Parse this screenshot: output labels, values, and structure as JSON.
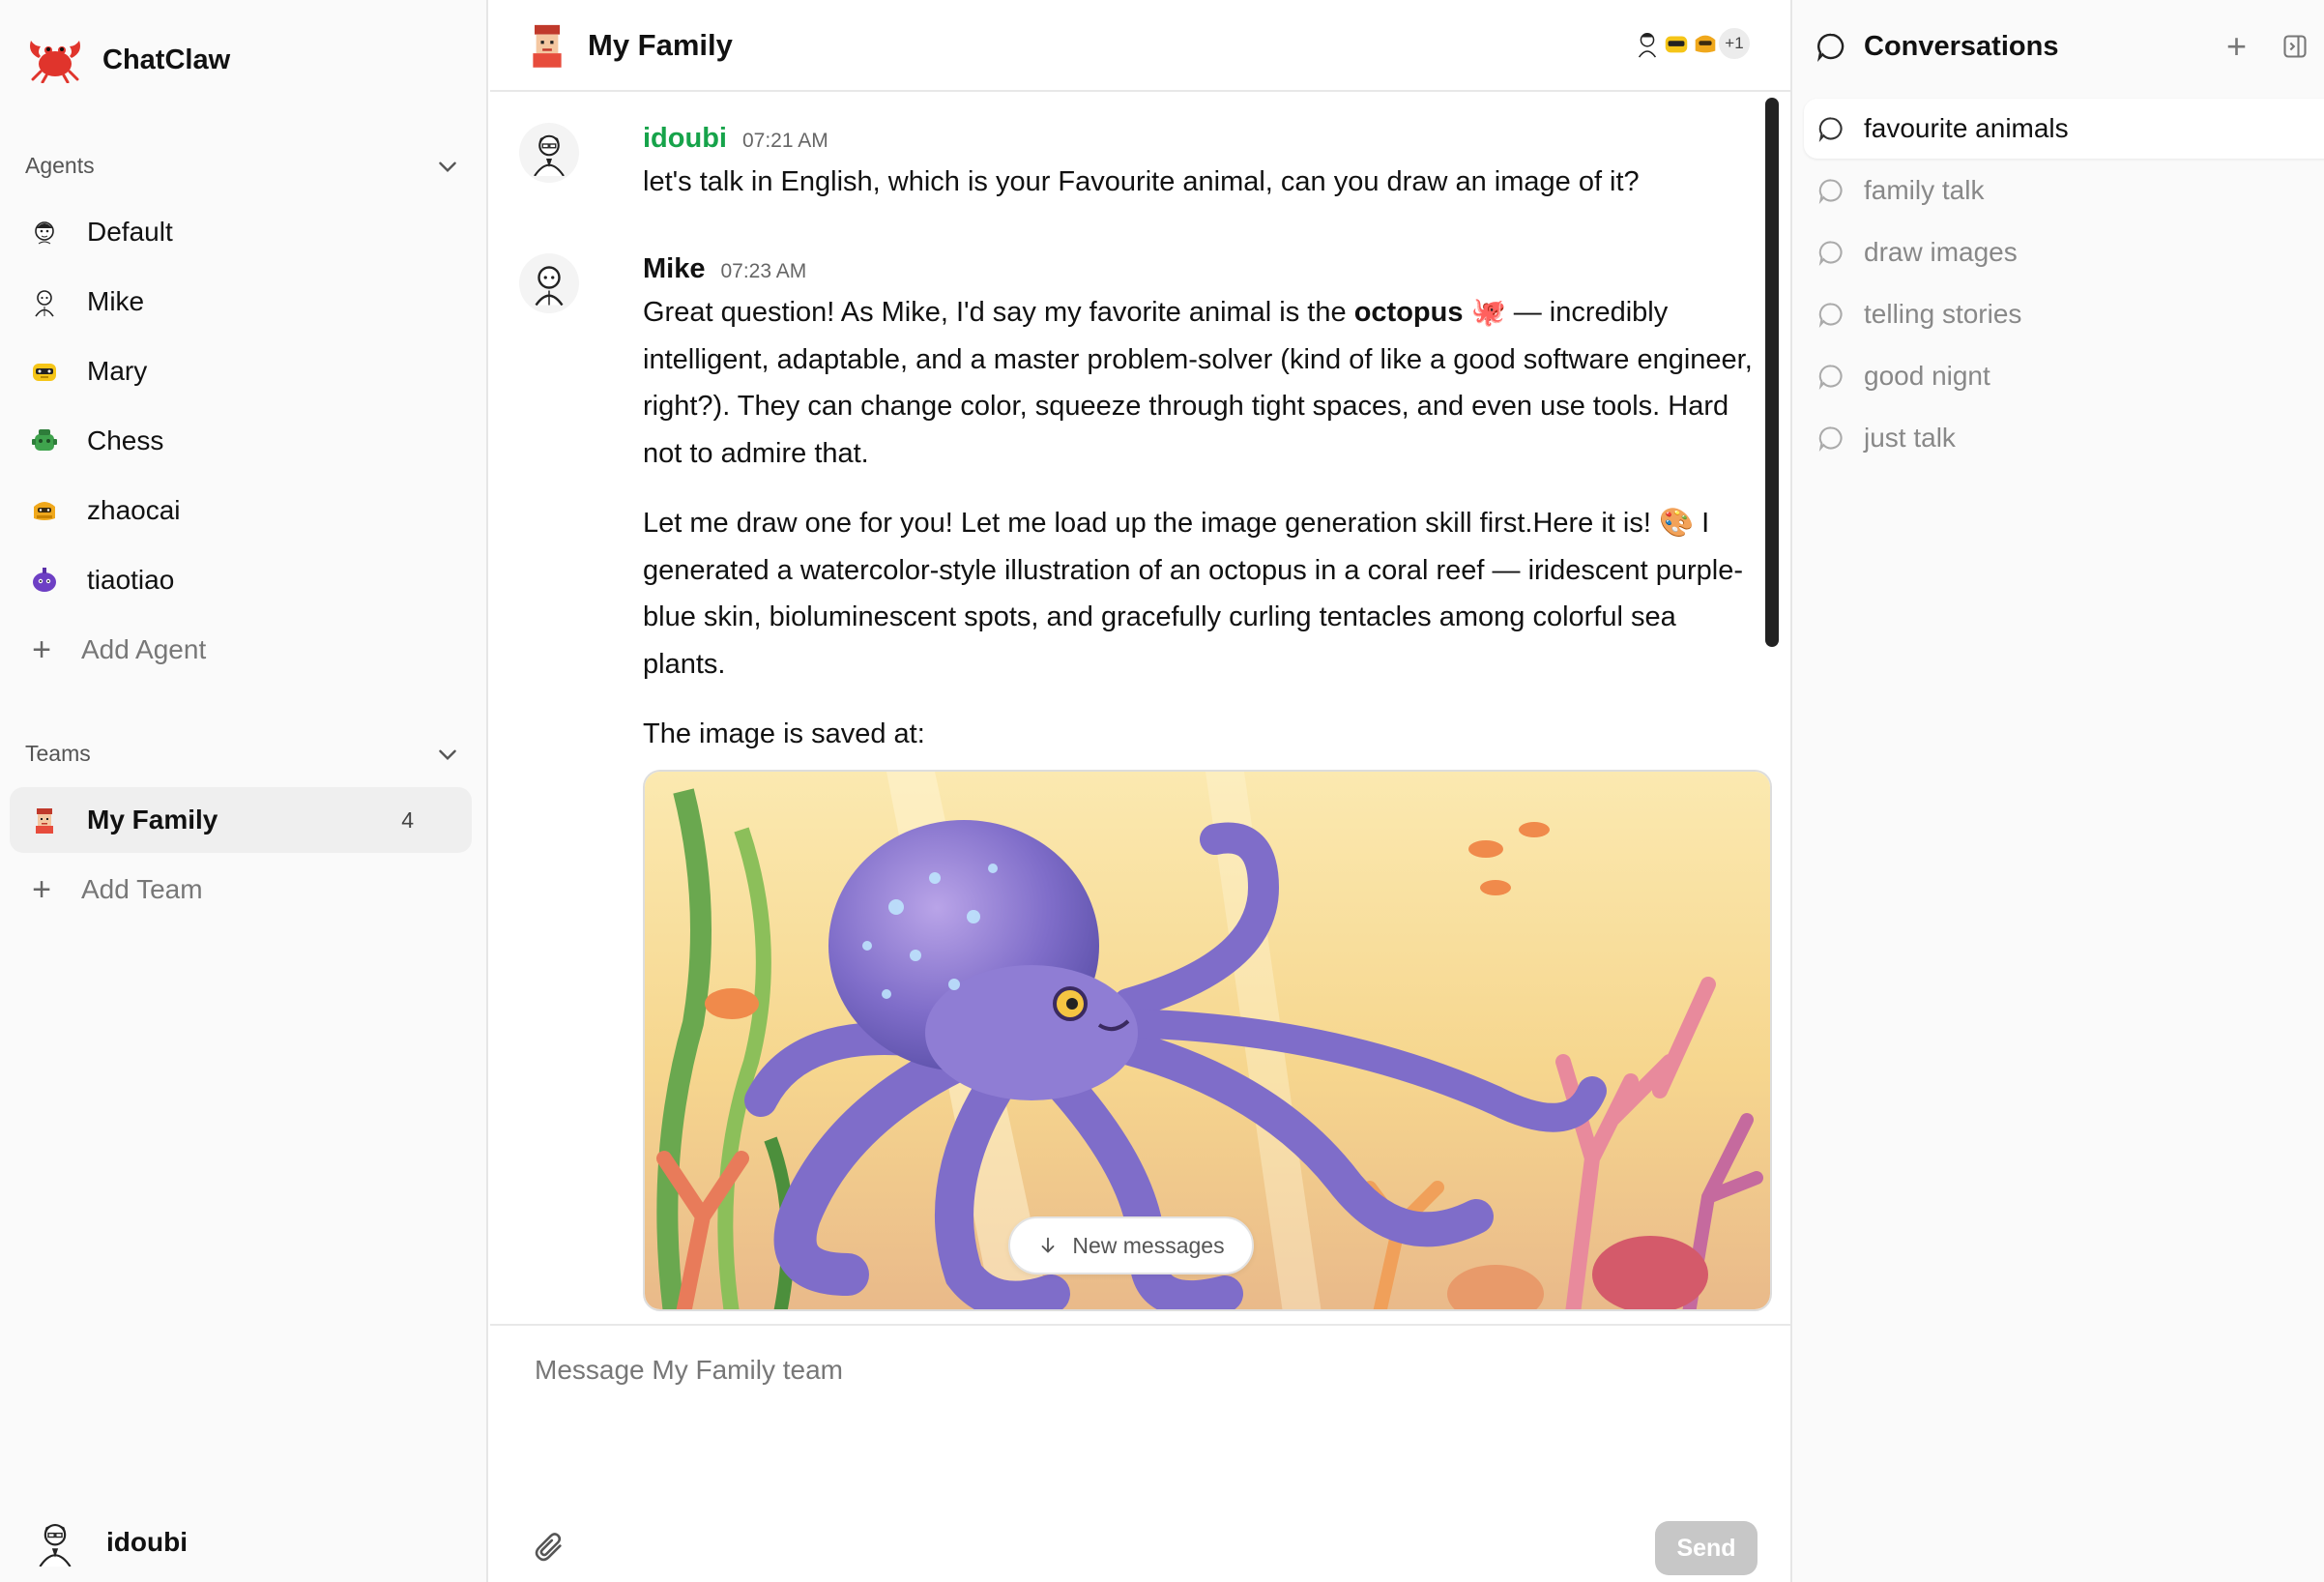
{
  "brand": {
    "name": "ChatClaw"
  },
  "agents": {
    "heading": "Agents",
    "items": [
      {
        "label": "Default",
        "icon": "sketch-face-icon"
      },
      {
        "label": "Mike",
        "icon": "sketch-man-icon"
      },
      {
        "label": "Mary",
        "icon": "yellow-robot-icon"
      },
      {
        "label": "Chess",
        "icon": "green-robot-icon"
      },
      {
        "label": "zhaocai",
        "icon": "gold-robot-icon"
      },
      {
        "label": "tiaotiao",
        "icon": "purple-robot-icon"
      }
    ],
    "add_label": "Add Agent"
  },
  "teams": {
    "heading": "Teams",
    "items": [
      {
        "label": "My Family",
        "count": "4",
        "icon": "pixel-family-icon"
      }
    ],
    "add_label": "Add Team"
  },
  "current_user": {
    "name": "idoubi"
  },
  "chat": {
    "title": "My Family",
    "members_more": "+1",
    "messages": [
      {
        "author": "idoubi",
        "author_color": "#16a34a",
        "time": "07:21 AM",
        "text": "let's talk in English, which is your Favourite animal, can you draw an image of it?"
      },
      {
        "author": "Mike",
        "author_color": "#111111",
        "time": "07:23 AM",
        "p1_before": "Great question! As Mike, I'd say my favorite animal is the ",
        "p1_bold": "octopus",
        "p1_emoji": " 🐙",
        "p1_after": " — incredibly intelligent, adaptable, and a master problem-solver (kind of like a good software engineer, right?). They can change color, squeeze through tight spaces, and even use tools. Hard not to admire that.",
        "p2": "Let me draw one for you! Let me load up the image generation skill first.Here it is! 🎨 I generated a watercolor-style illustration of an octopus in a coral reef — iridescent purple-blue skin, bioluminescent spots, and gracefully curling tentacles among colorful sea plants.",
        "p3": "The image is saved at:"
      }
    ],
    "new_messages_label": "New messages",
    "composer_placeholder": "Message My Family team",
    "send_label": "Send"
  },
  "conversations": {
    "heading": "Conversations",
    "items": [
      {
        "label": "favourite animals",
        "active": true
      },
      {
        "label": "family talk"
      },
      {
        "label": "draw images"
      },
      {
        "label": "telling stories"
      },
      {
        "label": "good nignt"
      },
      {
        "label": "just talk"
      }
    ]
  },
  "colors": {
    "accent_green": "#16a34a",
    "send_disabled": "#c7c7c7"
  }
}
